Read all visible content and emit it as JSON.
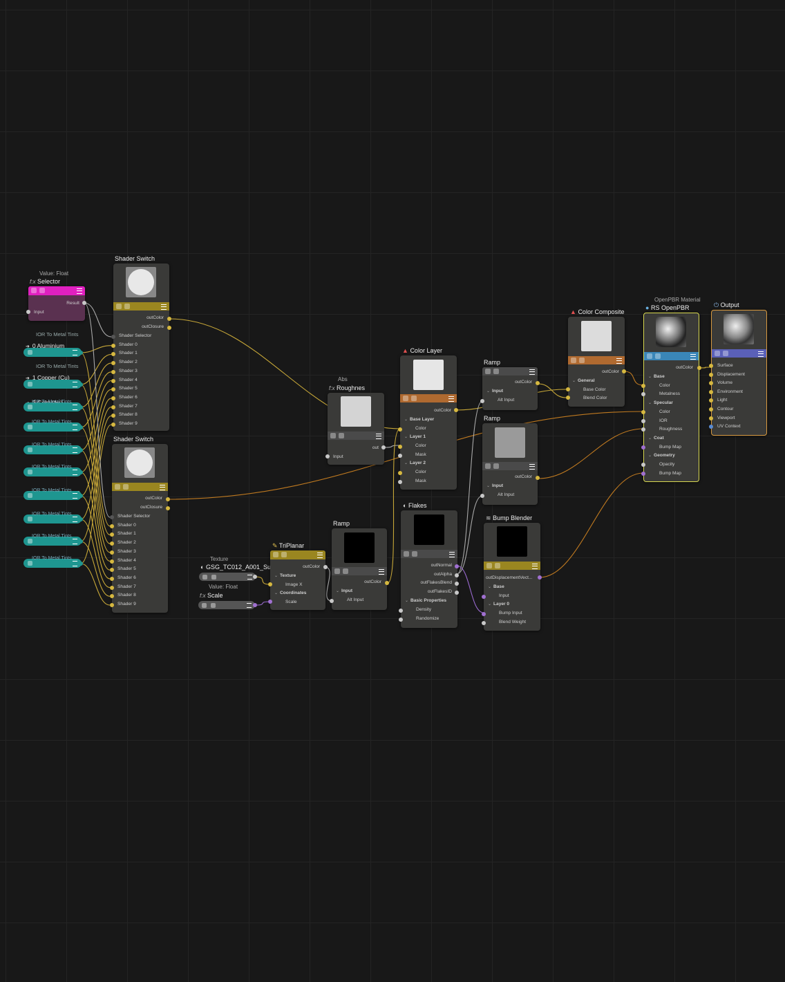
{
  "selector_node": {
    "caption": "Value: Float",
    "prefix": "f:x",
    "title": "Selector",
    "result": "Result",
    "input": "Input"
  },
  "ior_label": "IOR To Metal Tints",
  "ior_items": [
    {
      "name": "0 Aluminium"
    },
    {
      "name": "1 Copper (Cu)"
    },
    {
      "name": "2 Gold (Au)"
    },
    {
      "name": "3 Iron (Fe)"
    },
    {
      "name": "4 Platinum (Pt)"
    },
    {
      "name": "5 Silver (Ag)"
    },
    {
      "name": "6 Titanium (Ti)IOR"
    },
    {
      "name": "7 Chromium (Cr)"
    },
    {
      "name": "8 Brass (Cu-Zn)"
    },
    {
      "name": "9 Stainless steel"
    }
  ],
  "shader_switch": {
    "title": "Shader Switch",
    "outputs": [
      "outColor",
      "outClosure"
    ],
    "inputs": [
      "Shader Selector",
      "Shader 0",
      "Shader 1",
      "Shader 2",
      "Shader 3",
      "Shader 4",
      "Shader 5",
      "Shader 6",
      "Shader 7",
      "Shader 8",
      "Shader 9"
    ]
  },
  "roughness_node": {
    "caption": "Abs",
    "prefix": "f:x",
    "title": "Roughnes",
    "out": "out",
    "input": "Input"
  },
  "texture_node": {
    "caption": "Texture",
    "title": "GSG_TC012_A001_Subtl..."
  },
  "scale_node": {
    "caption": "Value: Float",
    "prefix": "f:x",
    "title": "Scale"
  },
  "triplanar": {
    "title": "TriPlanar",
    "out": "outColor",
    "sec1": "Texture",
    "p1": "Image X",
    "sec2": "Coordinates",
    "p2": "Scale"
  },
  "ramp": {
    "title": "Ramp",
    "out": "outColor",
    "sec": "Input",
    "p": "Alt Input"
  },
  "color_layer": {
    "title": "Color Layer",
    "out": "outColor",
    "rows": [
      "Base Layer",
      "Color",
      "Layer 1",
      "Color",
      "Mask",
      "Layer 2",
      "Color",
      "Mask"
    ]
  },
  "flakes": {
    "title": "Flakes",
    "outputs": [
      "outNormal",
      "outAlpha",
      "outFlakesBlend",
      "outFlakesID"
    ],
    "sec": "Basic Properties",
    "props": [
      "Density",
      "Randomize"
    ]
  },
  "bump_blender": {
    "title": "Bump Blender",
    "out": "outDisplacementVect...",
    "rows": [
      "Base",
      "Input",
      "Layer 0",
      "Bump Input",
      "Blend Weight"
    ]
  },
  "color_composite": {
    "title": "Color Composite",
    "out": "outColor",
    "sec": "General",
    "props": [
      "Base Color",
      "Blend Color"
    ]
  },
  "openpbr": {
    "caption": "OpenPBR Material",
    "title": "RS OpenPBR",
    "out": "outColor",
    "rows": [
      "Base",
      "Color",
      "Metalness",
      "Specular",
      "Color",
      "IOR",
      "Roughness",
      "Coat",
      "Bump Map",
      "Geometry",
      "Opacity",
      "Bump Map"
    ]
  },
  "output_node": {
    "title": "Output",
    "inputs": [
      "Surface",
      "Displacement",
      "Volume",
      "Environment",
      "Light",
      "Contour",
      "Viewport",
      "UV Context"
    ]
  },
  "colors": {
    "port_yellow": "#d6b840",
    "port_grey": "#c8c8c8",
    "port_purple": "#a070d0",
    "wire_yellow": "#c8a838",
    "wire_orange": "#c07a20",
    "teal": "#1e9690",
    "magenta": "#e020c0"
  }
}
